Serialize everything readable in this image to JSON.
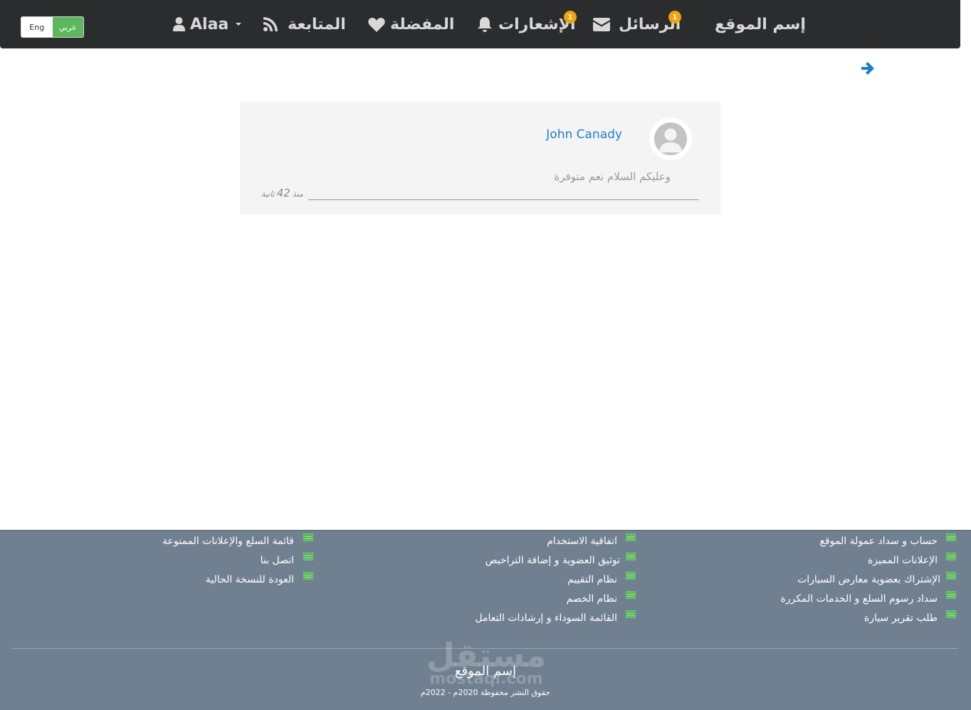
{
  "navbar": {
    "site_name": "إسم الموقع",
    "messages_label": "الرسائل",
    "messages_badge": "1",
    "notifications_label": "الإشعارات",
    "notifications_badge": "1",
    "favorites_label": "المفضلة",
    "following_label": "المتابعة",
    "user_name": "Alaa",
    "lang_en": "Eng",
    "lang_ar": "عربي"
  },
  "message": {
    "sender": "John Canady",
    "text": "وعليكم السلام نعم متوفرة",
    "time_prefix": "منذ",
    "time_value": "42",
    "time_unit": "ثانية"
  },
  "footer": {
    "col1": [
      "حساب و سداد عمولة الموقع",
      "الإعلانات المميزة",
      "الإشتراك بعضوية معارض السيارات",
      "سداد رسوم السلع و الخدمات المكررة",
      "طلب تقرير سيارة"
    ],
    "col2": [
      "اتفاقية الاستخدام",
      "توثيق العضوية و إضافة التراخيص",
      "نظام التقييم",
      "نظام الخصم",
      "القائمة السوداء و إرشادات التعامل"
    ],
    "col3": [
      "قائمة السلع والإعلانات الممنوعة",
      "اتصل بنا",
      "العودة للنسخة الحالية"
    ],
    "site_name": "إسم الموقع",
    "copyright": "حقوق النشر محفوظة 2020م - 2022م",
    "watermark": "مستقل",
    "watermark_sub": "mostaql.com"
  },
  "colors": {
    "navbar_bg": "#2b2c2e",
    "accent_blue": "#1e7fc8",
    "badge": "#f0a30a",
    "footer_bg": "#708090",
    "lang_active": "#5cb85c"
  }
}
